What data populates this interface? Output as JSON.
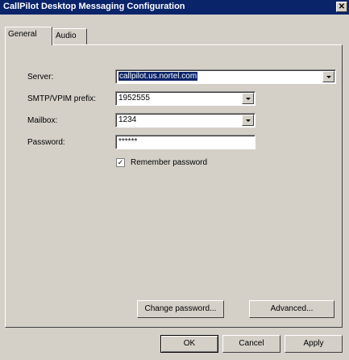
{
  "window": {
    "title": "CallPilot Desktop Messaging Configuration",
    "close": "✕"
  },
  "tabs": [
    {
      "label": "General",
      "active": true
    },
    {
      "label": "Audio",
      "active": false
    }
  ],
  "form": {
    "server_label": "Server:",
    "server_value": "callpilot.us.nortel.com",
    "smtp_label": "SMTP/VPIM prefix:",
    "smtp_value": "1952555",
    "mailbox_label": "Mailbox:",
    "mailbox_value": "1234",
    "password_label": "Password:",
    "password_value": "******",
    "remember_label": "Remember password",
    "remember_checked": true,
    "check_mark": "✓"
  },
  "panel_buttons": {
    "change_password": "Change password...",
    "advanced": "Advanced..."
  },
  "dialog_buttons": {
    "ok": "OK",
    "cancel": "Cancel",
    "apply": "Apply"
  }
}
